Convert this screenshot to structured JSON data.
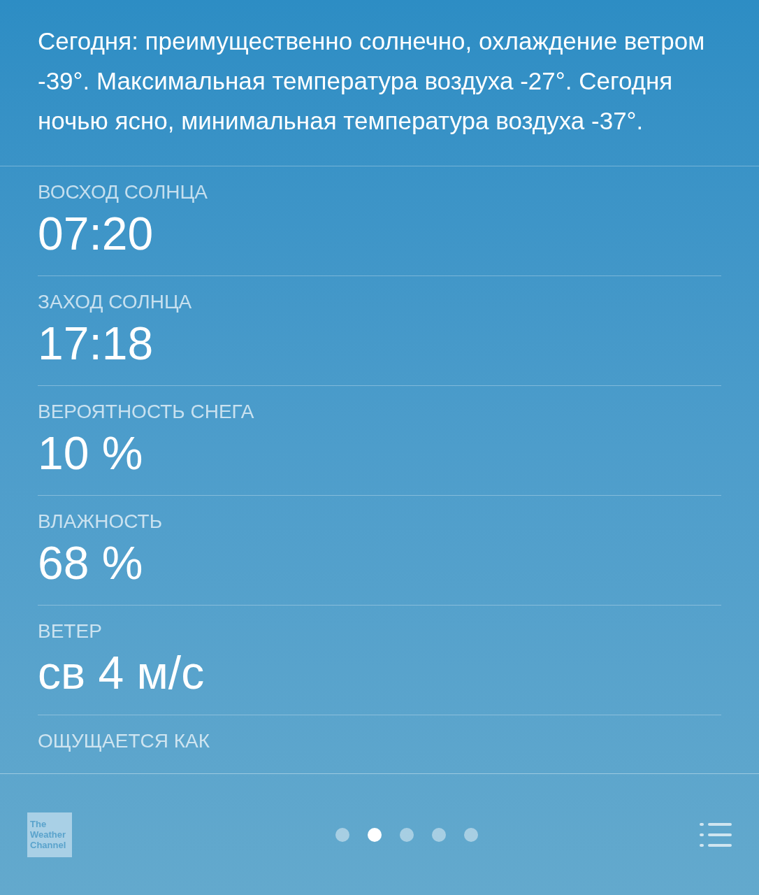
{
  "summary": "Сегодня: преимущественно солнечно, охлаждение ветром -39°. Максимальная температура воздуха -27°. Сегодня ночью ясно, минимальная температура воздуха -37°.",
  "details": [
    {
      "label": "ВОСХОД СОЛНЦА",
      "value": "07:20"
    },
    {
      "label": "ЗАХОД СОЛНЦА",
      "value": "17:18"
    },
    {
      "label": "ВЕРОЯТНОСТЬ СНЕГА",
      "value": "10 %"
    },
    {
      "label": "ВЛАЖНОСТЬ",
      "value": "68 %"
    },
    {
      "label": "ВЕТЕР",
      "value": "св 4 м/с"
    },
    {
      "label": "ОЩУЩАЕТСЯ КАК"
    }
  ],
  "footer": {
    "logo_lines": [
      "The",
      "Weather",
      "Channel"
    ],
    "pages": [
      {
        "selected": false
      },
      {
        "selected": true
      },
      {
        "selected": false
      },
      {
        "selected": false
      },
      {
        "selected": false
      }
    ]
  }
}
